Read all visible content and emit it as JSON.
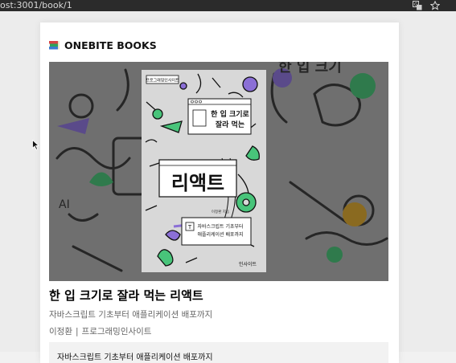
{
  "browser": {
    "url": "ost:3001/book/1",
    "translate_icon": "translate-icon",
    "star_icon": "star-icon"
  },
  "header": {
    "logo_icon": "book-emoji-icon",
    "title": "ONEBITE BOOKS"
  },
  "book": {
    "title": "한 입 크기로 잘라 먹는 리액트",
    "subtitle": "자바스크립트 기초부터 애플리케이션 배포까지",
    "author": "이정환",
    "separator": "|",
    "publisher": "프로그래밍인사이트",
    "description": "자바스크립트 기초부터 애플리케이션 배포까지",
    "cover": {
      "series_label": "프로그래밍인사이트",
      "title_line1": "한 입 크기로",
      "title_line2": "잘라 먹는",
      "big_title": "리액트",
      "tagline_line1": "자바스크립트 기초부터",
      "tagline_line2": "애플리케이션 배포까지",
      "author": "이정환 지음",
      "publisher_mark": "인사이트"
    }
  },
  "colors": {
    "browser_bar": "#2b2b2b",
    "page_bg": "#ececec",
    "card_bg": "#ffffff",
    "cover_bg": "#6e6e6e",
    "cover_paper": "#d9d9d9",
    "accent_green": "#48c47a",
    "accent_purple": "#8b6fd6"
  }
}
